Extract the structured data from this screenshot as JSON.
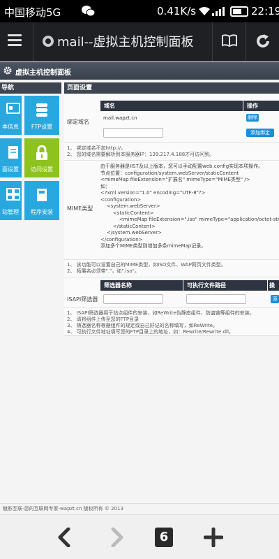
{
  "status_bar": {
    "carrier": "中国移动5G",
    "speed": "0.41K/s",
    "battery": "18",
    "time": "22:19"
  },
  "app_bar": {
    "title": "mail--虚拟主机控制面板"
  },
  "page": {
    "header_title": "虚拟主机控制面板",
    "nav_title": "导航",
    "content_title": "页面设置",
    "tiles": [
      {
        "label": "本信息",
        "color": "#29a8e0",
        "icon": "id-card-icon"
      },
      {
        "label": "FTP设置",
        "color": "#29a8e0",
        "icon": "database-icon"
      },
      {
        "label": "面设置",
        "color": "#29a8e0",
        "icon": "document-icon"
      },
      {
        "label": "访问设置",
        "color": "#8dc21f",
        "icon": "lock-icon"
      },
      {
        "label": "站管理",
        "color": "#29a8e0",
        "icon": "sitemap-icon"
      },
      {
        "label": "程序安装",
        "color": "#29a8e0",
        "icon": "package-icon"
      }
    ]
  },
  "domain_binding": {
    "label": "绑定域名",
    "col_domain": "域名",
    "col_action": "操作",
    "domain_value": "mail.wapzt.cn",
    "delete_label": "删除",
    "add_label": "添加绑定",
    "notes": [
      "1、 绑定域名不加http://。",
      "2、 您的域名需要解析到本服务器IP：139.217.4.188才可访问到。"
    ]
  },
  "mime": {
    "label": "MIME类型",
    "text": "由于服务器是IIS7及以上版本，您可以手动配置web.config实现本项操作。\n节点位置：configuration/system.webServer/staticContent\n<mimeMap fileExtension=\"扩展名\" mimeType=\"MIME类型\" />\n如：\n<?xml version=\"1.0\" encoding=\"UTF-8\"?>\n<configuration>\n    <system.webServer>\n        <staticContent>\n            <mimeMap fileExtension=\".iso\" mimeType=\"application/octet-stream\" />\n        </staticContent>\n    </system.webServer>\n</configuration>\n添加多个MIME类型则增加多条mimeMap记录。",
    "notes": [
      "1、 该功能可以设置自己的MIME类型，如ISO文件、WAP网页文件类型。",
      "2、 拓展名必须带\".\"，如\".iso\"。"
    ]
  },
  "isapi": {
    "label": "ISAPI筛选器",
    "col_name": "筛选器名称",
    "col_path": "可执行文件路径",
    "col_action": "操作",
    "add_label": "添",
    "notes": [
      "1、 ISAPI筛选器用于站点组件的安装，如ReWrite伪静态组件、防盗链等组件的安装。",
      "2、 请将组件上传至您的FTP目录",
      "3、 筛选器名称根据组件的规定或自己好记的名称填写，如ReWrite。",
      "4、 可执行文件地址填写您的FTP目录上的地址，如：Rewrite/Rewrite.dll。"
    ]
  },
  "footer": {
    "text": "魅影互联-您的互联网专家-wapzt.cn 版权所有 © 2013"
  },
  "bottom_bar": {
    "tab_count": "6"
  }
}
